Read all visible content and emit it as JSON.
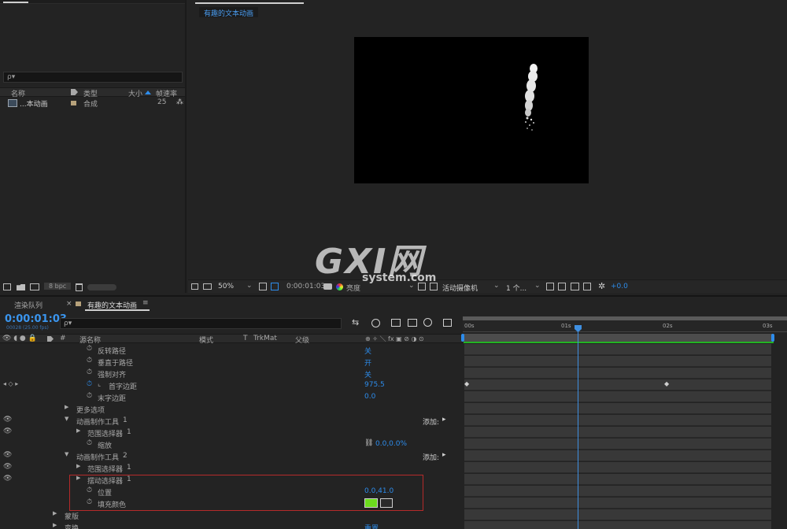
{
  "project": {
    "search_placeholder": "ρ▾",
    "columns": {
      "name": "名称",
      "type": "类型",
      "size": "大小",
      "framerate": "帧速率"
    },
    "items": [
      {
        "name": "...本动画",
        "type": "合成",
        "framerate": "25"
      }
    ],
    "bpc": "8 bpc"
  },
  "comp": {
    "tab": "有趣的文本动画",
    "toolbar": {
      "zoom": "50%",
      "timecode": "0:00:01:03",
      "view": "亮度",
      "camera": "活动摄像机",
      "views": "1 个...",
      "exposure": "+0.0"
    }
  },
  "watermark": {
    "main": "GXI网",
    "sub": "system.com"
  },
  "timeline": {
    "tabs": [
      {
        "label": "渲染队列"
      },
      {
        "label": "有趣的文本动画"
      }
    ],
    "timecode": "0:00:01:03",
    "frames": "00028 (25.00 fps)",
    "columns": {
      "hash": "#",
      "source": "源名称",
      "mode": "模式",
      "t": "T",
      "trkmat": "TrkMat",
      "parent": "父级"
    },
    "ruler": [
      "00s",
      "01s",
      "02s",
      "03s"
    ],
    "layers": [
      {
        "name": "反转路径",
        "value": "关"
      },
      {
        "name": "垂直于路径",
        "value": "开"
      },
      {
        "name": "强制对齐",
        "value": "关"
      },
      {
        "name": "首字边距",
        "value": "975.5"
      },
      {
        "name": "末字边距",
        "value": "0.0"
      },
      {
        "name": "更多选项",
        "value": ""
      },
      {
        "name": "动画制作工具",
        "num": "1",
        "add": "添加:"
      },
      {
        "name": "范围选择器",
        "num": "1"
      },
      {
        "name": "缩放",
        "value": "0.0,0.0%"
      },
      {
        "name": "动画制作工具",
        "num": "2",
        "add": "添加:"
      },
      {
        "name": "范围选择器",
        "num": "1"
      },
      {
        "name": "摆动选择器",
        "num": "1"
      },
      {
        "name": "位置",
        "value": "0.0,41.0"
      },
      {
        "name": "填充颜色",
        "value": ""
      },
      {
        "name": "蒙版",
        "value": ""
      },
      {
        "name": "变换",
        "value": "重置"
      }
    ],
    "fill_color": "#6cdc1e",
    "highlight_color": "#b52a2a"
  }
}
